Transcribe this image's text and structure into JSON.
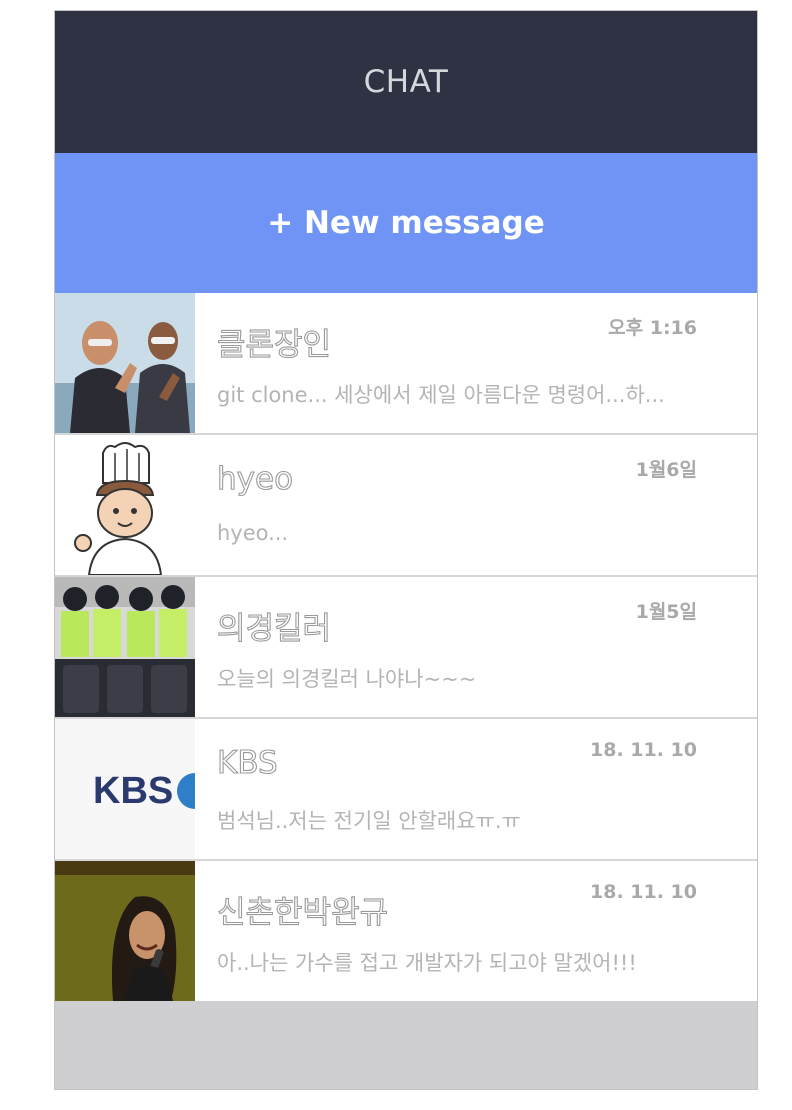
{
  "header": {
    "title": "CHAT"
  },
  "new_message": {
    "label": "+ New message"
  },
  "chats": [
    {
      "name": "클론장인",
      "time": "오후 1:16",
      "preview": "git clone... 세상에서 제일 아름다운 명령어...하..."
    },
    {
      "name": "hyeo",
      "time": "1월6일",
      "preview": "hyeo..."
    },
    {
      "name": "의경킬러",
      "time": "1월5일",
      "preview": "오늘의 의경킬러 나야나~~~"
    },
    {
      "name": "KBS",
      "time": "18. 11. 10",
      "preview": "범석님..저는 전기일 안할래요ㅠ.ㅠ",
      "avatar_text": "KBS"
    },
    {
      "name": "신촌한박완규",
      "time": "18. 11. 10",
      "preview": "아..나는 가수를 접고 개발자가 되고야 말겠어!!!"
    }
  ],
  "colors": {
    "header_bg": "#2f3242",
    "new_message_bg": "#7094f5",
    "kbs_blue": "#2a3a6e"
  }
}
